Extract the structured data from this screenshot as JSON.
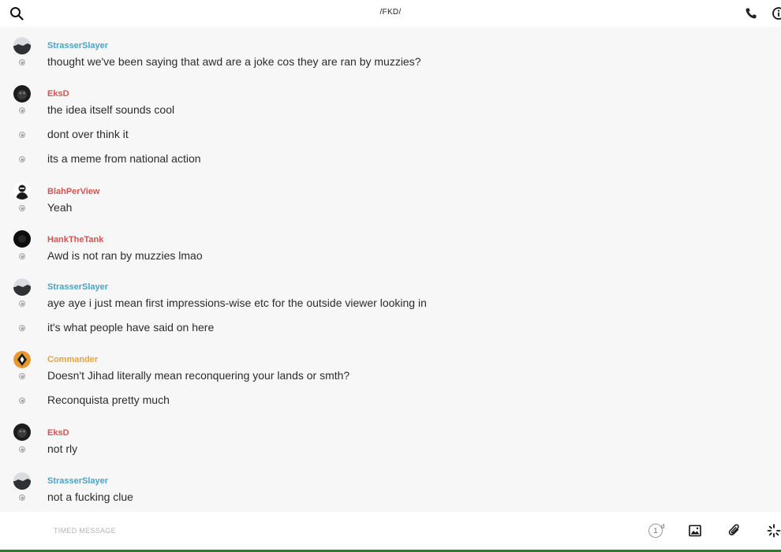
{
  "header": {
    "title": "/FKD/",
    "icons": {
      "search": "search-icon",
      "phone": "phone-icon",
      "info": "info-icon"
    }
  },
  "messages": [
    {
      "author": "StrasserSlayer",
      "color": "#4aa3c8",
      "lines": [
        "thought we've been saying that awd are a joke cos they are ran by muzzies?"
      ]
    },
    {
      "author": "EksD",
      "color": "#d9534f",
      "lines": [
        "the idea itself sounds cool",
        "dont over think it",
        "its a meme from national action"
      ]
    },
    {
      "author": "BlahPerView",
      "color": "#d9534f",
      "lines": [
        "Yeah"
      ]
    },
    {
      "author": "HankTheTank",
      "color": "#d9534f",
      "lines": [
        "Awd is not ran by muzzies lmao"
      ]
    },
    {
      "author": "StrasserSlayer",
      "color": "#4aa3c8",
      "lines": [
        "aye aye i just mean first impressions-wise etc for the outside viewer looking in",
        "it's what people have said on here"
      ]
    },
    {
      "author": "Commander",
      "color": "#e8a33a",
      "lines": [
        "Doesn't Jihad literally mean reconquering your lands or smth?",
        "Reconquista pretty much"
      ]
    },
    {
      "author": "EksD",
      "color": "#d9534f",
      "lines": [
        "not rly"
      ]
    },
    {
      "author": "StrasserSlayer",
      "color": "#4aa3c8",
      "lines": [
        "not a fucking clue"
      ]
    }
  ],
  "composer": {
    "placeholder": "TIMED MESSAGE",
    "timer_value": "1",
    "timer_unit": "d",
    "icons": {
      "image": "image-icon",
      "attach": "paperclip-icon",
      "effects": "sparkle-icon"
    }
  }
}
